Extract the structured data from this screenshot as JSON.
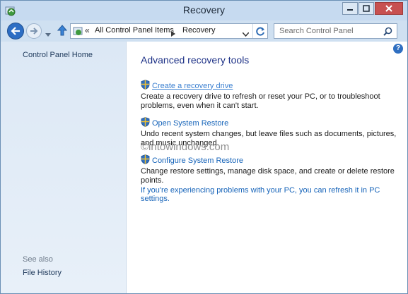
{
  "window": {
    "title": "Recovery"
  },
  "icons": {
    "app": "recovery-app-icon",
    "back": "back-arrow-icon",
    "forward": "forward-arrow-icon",
    "up": "up-arrow-icon",
    "refresh": "refresh-icon",
    "search": "search-icon",
    "help": "help-icon",
    "shield": "uac-shield-icon"
  },
  "address": {
    "overflow": "«",
    "items": [
      "All Control Panel Items",
      "Recovery"
    ]
  },
  "search": {
    "placeholder": "Search Control Panel"
  },
  "sidebar": {
    "home": "Control Panel Home",
    "see_also": "See also",
    "file_history": "File History"
  },
  "main": {
    "heading": "Advanced recovery tools",
    "help": "?",
    "items": [
      {
        "title": "Create a recovery drive",
        "desc": "Create a recovery drive to refresh or reset your PC, or to troubleshoot problems, even when it can't start."
      },
      {
        "title": "Open System Restore",
        "desc": "Undo recent system changes, but leave files such as documents, pictures, and music unchanged."
      },
      {
        "title": "Configure System Restore",
        "desc": "Change restore settings, manage disk space, and create or delete restore points."
      }
    ],
    "refresh_link": "If you're experiencing problems with your PC, you can refresh it in PC settings."
  },
  "watermark": "©intowindows.com",
  "colors": {
    "link": "#1563b9",
    "heading": "#1e3287",
    "sidebar_bg": "#dce8f5",
    "titlebar": "#c6daf0"
  }
}
